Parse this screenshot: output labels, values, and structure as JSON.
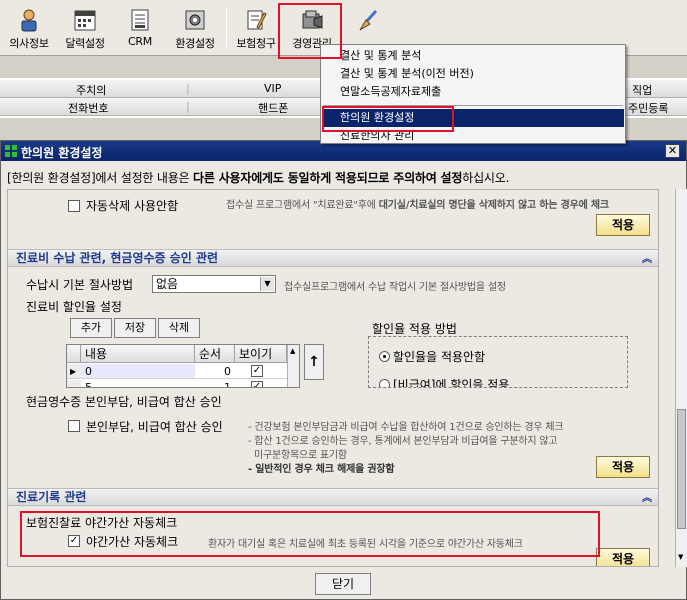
{
  "toolbar": {
    "buttons": [
      {
        "label": "의사정보",
        "icon": "doctor-icon"
      },
      {
        "label": "달력설정",
        "icon": "calendar-icon"
      },
      {
        "label": "CRM",
        "icon": "crm-icon"
      },
      {
        "label": "환경설정",
        "icon": "settings-icon"
      },
      {
        "label": "보험청구",
        "icon": "insurance-claim-icon"
      },
      {
        "label": "경영관리",
        "icon": "management-icon"
      },
      {
        "label": "",
        "icon": "broom-icon"
      }
    ]
  },
  "background_grid": {
    "row1": [
      "주치의",
      "VIP",
      "직업"
    ],
    "row2": [
      "전화번호",
      "핸드폰",
      "주민등록"
    ]
  },
  "dropdown_menu": {
    "items": [
      "결산 및 통계 분석",
      "결산 및 통계 분석(이전 버전)",
      "연말소득공제자료제출",
      "한의원 환경설정",
      "진료한의사 관리"
    ],
    "selected_index": 3
  },
  "dialog": {
    "title": "한의원 환경설정",
    "close_label": "✕",
    "notice": {
      "part1": "[한의원 환경설정]에서 설정한 내용은 ",
      "bold": "다른 사용자에게도 동일하게 적용되므로 주의하여 설정",
      "part2": "하십시오."
    },
    "auto_delete": {
      "label": "자동삭제 사용안함",
      "desc_prefix": "접수실 프로그램에서 \"치료완료\"후에 ",
      "desc_bold": "대기실/치료실의 명단을 삭제하지 않고 하는 경우에 체크",
      "checked": false,
      "apply_label": "적용"
    },
    "section_payment": {
      "title": "진료비 수납 관련, 현금영수증 승인 관련",
      "cut_method_label": "수납시 기본 절사방법",
      "cut_method_value": "없음",
      "cut_method_desc": "접수실프로그램에서 수납 작업시 기본 절사방법을 설정",
      "discount_label": "진료비 할인율 설정",
      "add_label": "추가",
      "save_label": "저장",
      "delete_label": "삭제",
      "grid_headers": [
        "내용",
        "순서",
        "보이기"
      ],
      "grid_rows": [
        {
          "content": "0",
          "order": "0",
          "visible": true
        },
        {
          "content": "5",
          "order": "1",
          "visible": true
        }
      ],
      "move_up_label": "↑",
      "discount_method_label": "할인율 적용 방법",
      "radio_options": [
        "할인율을 적용안함",
        "[비급여]에 할인을 적용"
      ],
      "radio_selected": 0,
      "receipt_label": "현금영수증 본인부담, 비급여 합산 승인",
      "receipt_check_label": "본인부담, 비급여 합산 승인",
      "receipt_checked": false,
      "receipt_desc1": "- 건강보험 본인부담금과 비급여 수납을 합산하여 1건으로 승인하는 경우 체크",
      "receipt_desc2": "- 합산 1건으로 승인하는 경우, 통계에서 본인부담과 비급여을 구분하지 않고",
      "receipt_desc3": "  미구분항목으로 표기함",
      "receipt_desc4": "- 일반적인 경우 체크 해제을 권장함",
      "apply_label": "적용"
    },
    "section_record": {
      "title": "진료기록 관련",
      "night_label": "보험진찰료 야간가산 자동체크",
      "night_check_label": "야간가산 자동체크",
      "night_checked": true,
      "night_desc": "환자가 대기실 혹은 치료실에 최초 등록된 시각을 기준으로 야간가산 자동체크",
      "apply_label": "적용"
    },
    "close_button_label": "닫기"
  },
  "colors": {
    "highlight_box": "#e0102a",
    "menu_selected": "#0a246a",
    "section_title": "#1f3a8a"
  }
}
